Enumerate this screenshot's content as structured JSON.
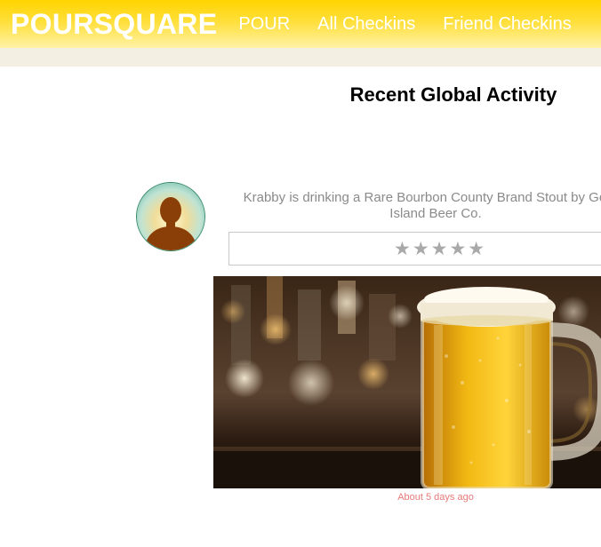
{
  "navbar": {
    "brand": "POURSQUARE",
    "links": [
      "POUR",
      "All Checkins",
      "Friend Checkins"
    ],
    "background_color": "#ffd400",
    "text_color": "#ffffff"
  },
  "page": {
    "title": "Recent Global Activity"
  },
  "checkin": {
    "text": "Krabby is drinking a Rare Bourbon County Brand Stout by Goose Island Beer Co.",
    "rating_stars": "★★★★★",
    "rating_max": 5,
    "timestamp": "About 5 days ago",
    "timestamp_color": "#e87a7a",
    "avatar_icon": "default-user-silhouette-icon",
    "photo_subject": "beer-mug-photo"
  }
}
